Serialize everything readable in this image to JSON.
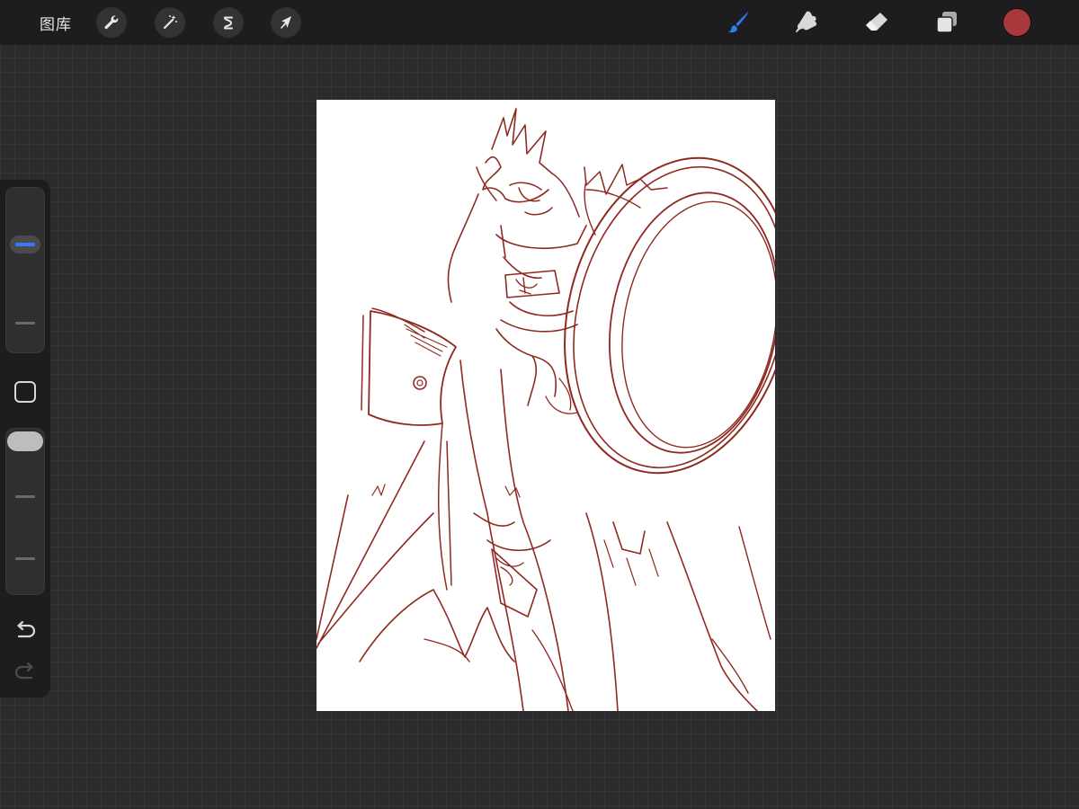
{
  "toolbar": {
    "gallery_label": "图库",
    "left_tools": [
      "wrench-icon",
      "magic-wand-icon",
      "selection-icon",
      "transform-arrow-icon"
    ],
    "right_tools": [
      "brush-icon",
      "smudge-icon",
      "eraser-icon",
      "layers-icon"
    ],
    "active_tool": "brush-icon",
    "current_color": "#a8383a"
  },
  "sidebar": {
    "brush_size_level": 0.68,
    "opacity_level": 1.0,
    "accent_color": "#2f7ef5"
  },
  "canvas": {
    "stroke_color": "#8e2a22",
    "background": "#ffffff"
  }
}
